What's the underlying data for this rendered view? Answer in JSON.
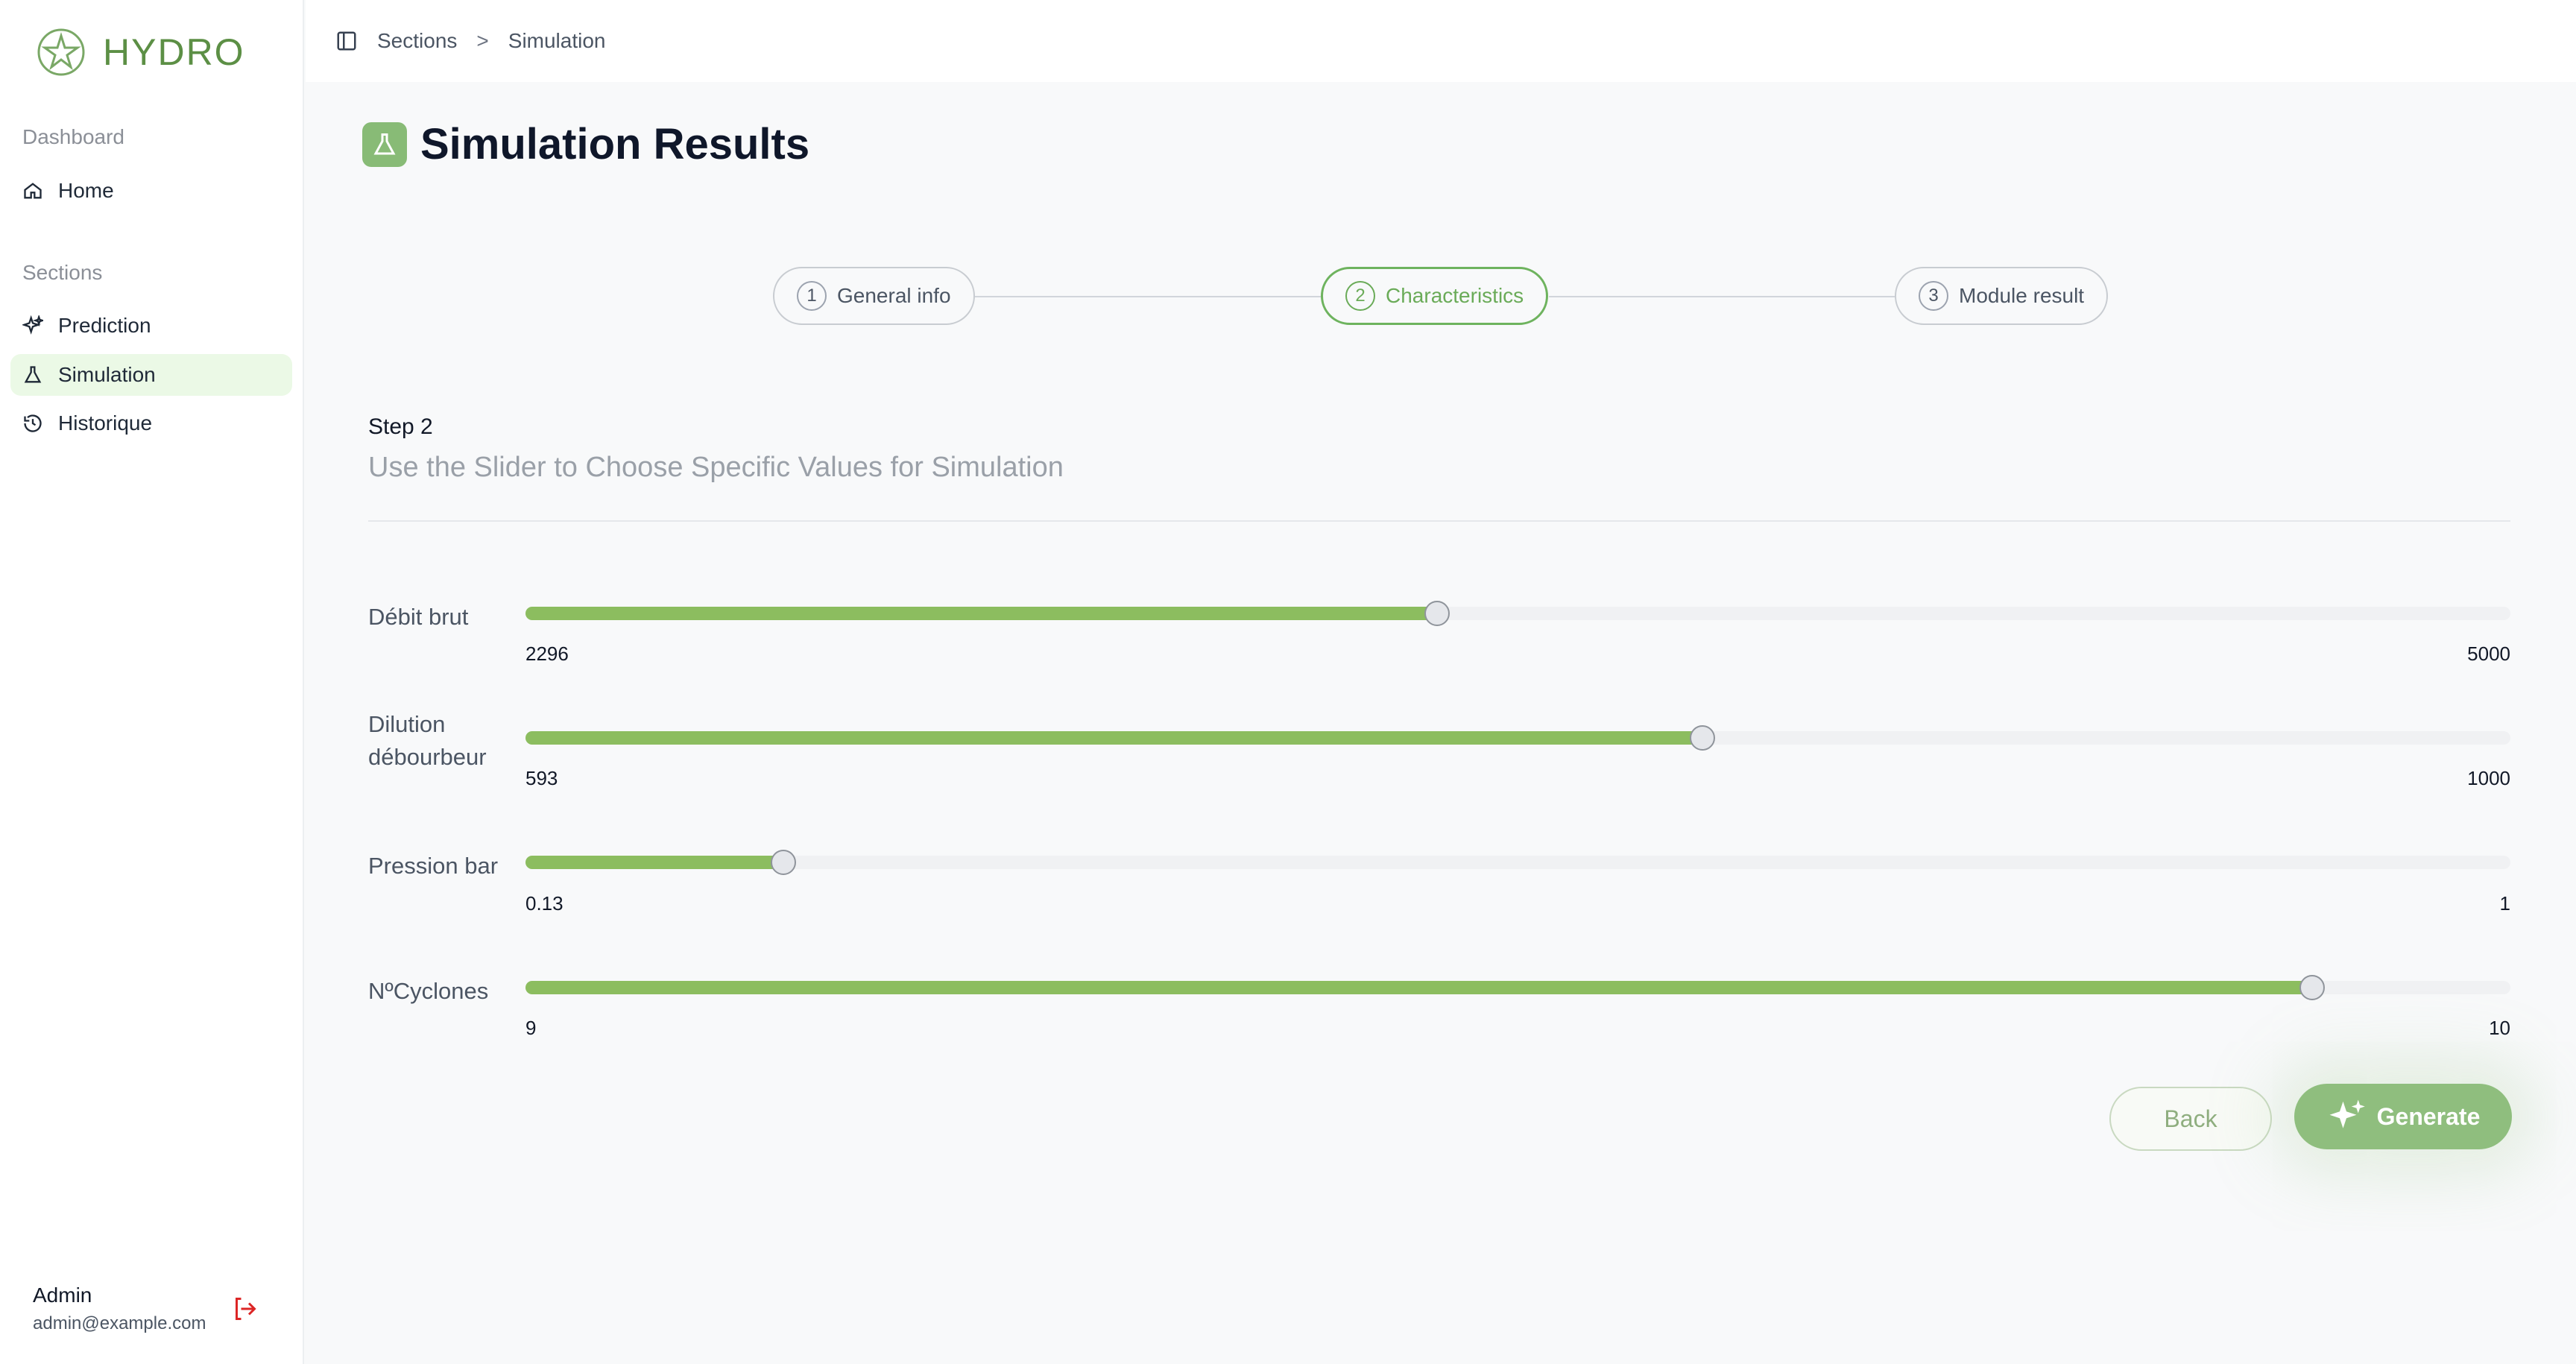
{
  "brand": {
    "name": "HYDRO",
    "color": "#5c8f45"
  },
  "sidebar": {
    "sections": [
      {
        "title": "Dashboard",
        "items": [
          {
            "label": "Home",
            "icon": "home-icon"
          }
        ]
      },
      {
        "title": "Sections",
        "items": [
          {
            "label": "Prediction",
            "icon": "sparkles-icon"
          },
          {
            "label": "Simulation",
            "icon": "flask-icon",
            "active": true
          },
          {
            "label": "Historique",
            "icon": "history-icon"
          }
        ]
      }
    ],
    "user": {
      "name": "Admin",
      "email": "admin@example.com"
    }
  },
  "breadcrumb": {
    "items": [
      "Sections",
      "Simulation"
    ],
    "separator": ">"
  },
  "page": {
    "title": "Simulation Results"
  },
  "stepper": [
    {
      "number": "1",
      "label": "General info",
      "active": false
    },
    {
      "number": "2",
      "label": "Characteristics",
      "active": true
    },
    {
      "number": "3",
      "label": "Module result",
      "active": false
    }
  ],
  "step": {
    "heading": "Step 2",
    "subtitle": "Use the Slider to Choose Specific Values for Simulation"
  },
  "sliders": [
    {
      "label": "Débit brut",
      "value": 2296,
      "min": 0,
      "max": 5000,
      "value_text": "2296",
      "max_text": "5000"
    },
    {
      "label": "Dilution débourbeur",
      "value": 593,
      "min": 0,
      "max": 1000,
      "value_text": "593",
      "max_text": "1000"
    },
    {
      "label": "Pression bar",
      "value": 0.13,
      "min": 0,
      "max": 1,
      "value_text": "0.13",
      "max_text": "1"
    },
    {
      "label": "NºCyclones",
      "value": 9,
      "min": 0,
      "max": 10,
      "value_text": "9",
      "max_text": "10"
    }
  ],
  "actions": {
    "back_label": "Back",
    "generate_label": "Generate"
  },
  "colors": {
    "accent": "#8cbd5f",
    "active_bg": "#ebf9e6",
    "logout": "#dc2626"
  }
}
